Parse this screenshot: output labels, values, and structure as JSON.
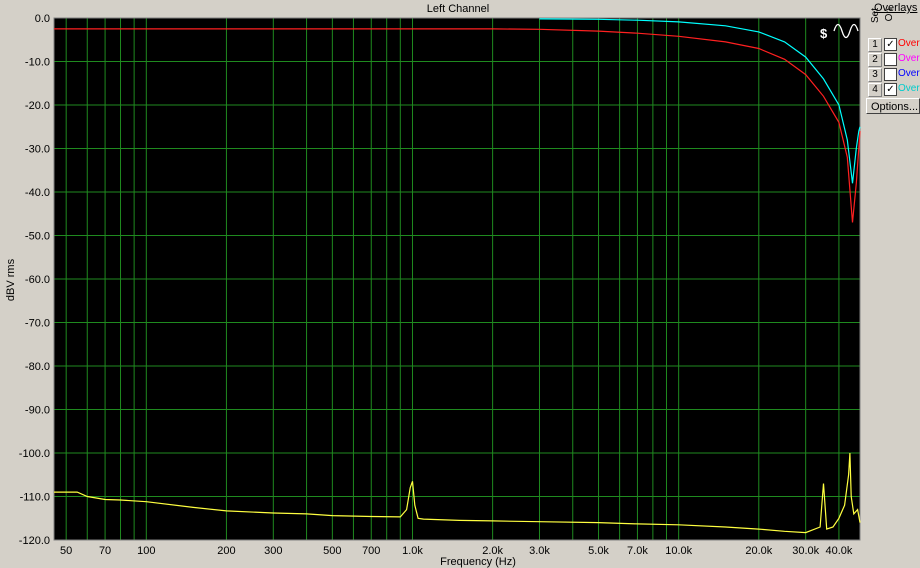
{
  "chart_data": {
    "type": "line",
    "title": "Left Channel",
    "xlabel": "Frequency (Hz)",
    "ylabel": "dBV rms",
    "xscale": "log",
    "xlim": [
      45,
      48000
    ],
    "ylim": [
      -120,
      0
    ],
    "grid": true,
    "yticks": [
      0,
      -10,
      -20,
      -30,
      -40,
      -50,
      -60,
      -70,
      -80,
      -90,
      -100,
      -110,
      -120
    ],
    "ytick_labels": [
      "0.0",
      "-10.0",
      "-20.0",
      "-30.0",
      "-40.0",
      "-50.0",
      "-60.0",
      "-70.0",
      "-80.0",
      "-90.0",
      "-100.0",
      "-110.0",
      "-120.0"
    ],
    "xticks": [
      50,
      70,
      100,
      200,
      300,
      500,
      700,
      1000,
      2000,
      3000,
      5000,
      7000,
      10000,
      20000,
      30000,
      40000
    ],
    "xtick_labels": [
      "50",
      "70",
      "100",
      "200",
      "300",
      "500",
      "700",
      "1.0k",
      "2.0k",
      "3.0k",
      "5.0k",
      "7.0k",
      "10.0k",
      "20.0k",
      "30.0k",
      "40.0k"
    ],
    "series": [
      {
        "color": "#ff2020",
        "x": [
          45,
          100,
          500,
          1000,
          2000,
          3000,
          5000,
          7000,
          10000,
          15000,
          20000,
          25000,
          30000,
          35000,
          40000,
          43000,
          45000,
          46500,
          47500,
          48000
        ],
        "y": [
          -2.5,
          -2.5,
          -2.5,
          -2.5,
          -2.5,
          -2.6,
          -3.0,
          -3.5,
          -4.2,
          -5.5,
          -7.0,
          -9.5,
          -13.0,
          -18.0,
          -24.0,
          -32.0,
          -47.0,
          -38.0,
          -30.0,
          -26.0
        ]
      },
      {
        "color": "#00ffff",
        "x": [
          3000,
          5000,
          7000,
          10000,
          15000,
          20000,
          25000,
          30000,
          35000,
          40000,
          43000,
          45000,
          46500,
          47500,
          48000
        ],
        "y": [
          -0.2,
          -0.3,
          -0.5,
          -0.9,
          -1.8,
          -3.2,
          -5.5,
          -9.0,
          -14.0,
          -20.0,
          -28.0,
          -38.0,
          -30.0,
          -26.0,
          -25.0
        ]
      },
      {
        "color": "#ffff40",
        "x": [
          45,
          55,
          60,
          70,
          80,
          100,
          150,
          200,
          300,
          400,
          500,
          700,
          900,
          950,
          980,
          1000,
          1020,
          1050,
          1100,
          1500,
          2000,
          3000,
          5000,
          7000,
          10000,
          15000,
          20000,
          25000,
          30000,
          34000,
          35000,
          36000,
          38000,
          40000,
          42000,
          43500,
          44000,
          44500,
          45500,
          47000,
          48000
        ],
        "y": [
          -109,
          -109,
          -110,
          -110.7,
          -110.8,
          -111.2,
          -112.5,
          -113.3,
          -113.8,
          -114,
          -114.4,
          -114.6,
          -114.7,
          -113,
          -108,
          -106.5,
          -112,
          -115,
          -115.2,
          -115.5,
          -115.6,
          -115.8,
          -116,
          -116.3,
          -116.5,
          -117,
          -117.5,
          -118,
          -118.3,
          -117,
          -107,
          -117.5,
          -117,
          -115,
          -112,
          -105,
          -100,
          -110,
          -114,
          -113,
          -116
        ]
      }
    ]
  },
  "overlay": {
    "title": "Overlays",
    "col_set": "Set",
    "col_on": "On",
    "rows": [
      {
        "num": "1",
        "check": "✓",
        "name": "Overlay",
        "color": "#ff0000"
      },
      {
        "num": "2",
        "check": "",
        "name": "Overlay",
        "color": "#ff00ff"
      },
      {
        "num": "3",
        "check": "",
        "name": "Overlay",
        "color": "#0000ff"
      },
      {
        "num": "4",
        "check": "✓",
        "name": "Overlay",
        "color": "#00cccc"
      }
    ],
    "options_label": "Options..."
  },
  "toolbar": {
    "icon_symbol": "$"
  }
}
